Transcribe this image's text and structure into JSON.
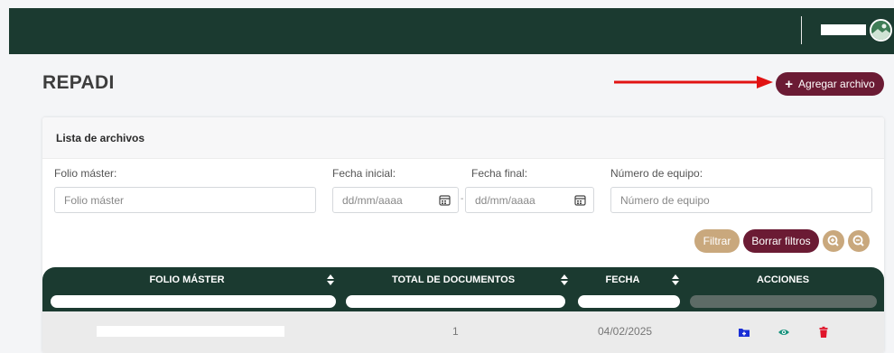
{
  "page": {
    "title": "REPADI"
  },
  "header": {
    "colors": {
      "bar": "#1b3a30"
    }
  },
  "toolbar": {
    "add_label": "Agregar archivo"
  },
  "card": {
    "title": "Lista de archivos"
  },
  "filters": {
    "folio_label": "Folio máster:",
    "folio_placeholder": "Folio máster",
    "start_label": "Fecha inicial:",
    "start_placeholder": "dd/mm/aaaa",
    "end_label": "Fecha final:",
    "end_placeholder": "dd/mm/aaaa",
    "equipo_label": "Número de equipo:",
    "equipo_placeholder": "Número de equipo",
    "filter_button": "Filtrar",
    "clear_button": "Borrar filtros"
  },
  "table": {
    "columns": [
      "FOLIO MÁSTER",
      "TOTAL DE DOCUMENTOS",
      "FECHA",
      "ACCIONES"
    ],
    "rows": [
      {
        "folio": "",
        "total": "1",
        "fecha": "04/02/2025"
      }
    ]
  },
  "colors": {
    "primary": "#1b3a30",
    "accent": "#6b1b34",
    "secondary": "#c9a87d",
    "arrow": "#e11313"
  }
}
